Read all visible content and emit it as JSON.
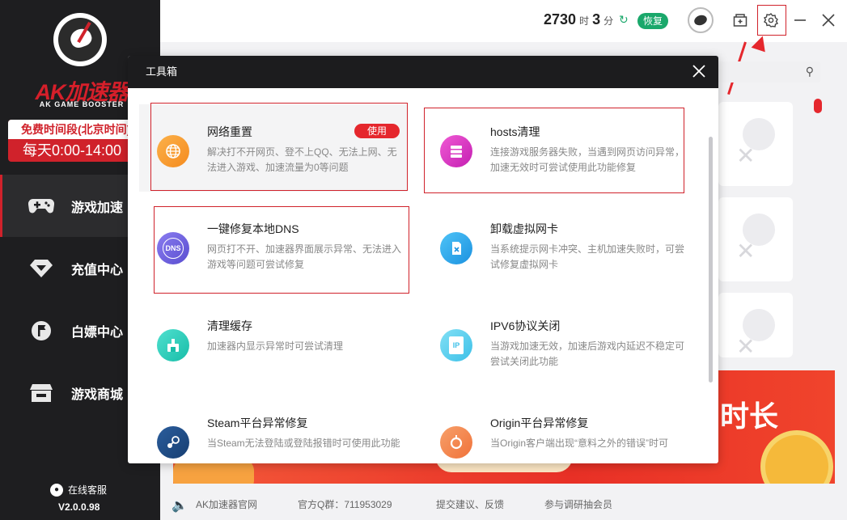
{
  "sidebar": {
    "brand": "AK加速器",
    "brand_sub": "AK GAME BOOSTER",
    "free_period_label": "免费时间段(北京时间)",
    "free_period_time": "每天0:00-14:00",
    "items": [
      {
        "label": "游戏加速",
        "icon": "gamepad-icon",
        "active": true
      },
      {
        "label": "充值中心",
        "icon": "diamond-icon",
        "active": false
      },
      {
        "label": "白嫖中心",
        "icon": "flag-badge-icon",
        "active": false
      },
      {
        "label": "游戏商城",
        "icon": "store-icon",
        "active": false
      }
    ],
    "support": "在线客服",
    "version": "V2.0.0.98"
  },
  "topbar": {
    "hours": "2730",
    "hours_unit": "时",
    "minutes": "3",
    "minutes_unit": "分",
    "restore_label": "恢复",
    "accent_color": "#1aa86b"
  },
  "modal": {
    "title": "工具箱",
    "tools": [
      {
        "title": "网络重置",
        "desc": "解决打不开网页、登不上QQ、无法上网、无法进入游戏、加速流量为0等问题",
        "icon": "globe-icon",
        "action": "使用"
      },
      {
        "title": "hosts清理",
        "desc": "连接游戏服务器失败，当遇到网页访问异常，加速无效时可尝试使用此功能修复",
        "icon": "server-icon"
      },
      {
        "title": "一键修复本地DNS",
        "desc": "网页打不开、加速器界面展示异常、无法进入游戏等问题可尝试修复",
        "icon": "dns-icon",
        "icon_text": "DNS"
      },
      {
        "title": "卸载虚拟网卡",
        "desc": "当系统提示网卡冲突、主机加速失败时，可尝试修复虚拟网卡",
        "icon": "network-card-icon"
      },
      {
        "title": "清理缓存",
        "desc": "加速器内显示异常时可尝试清理",
        "icon": "broom-icon"
      },
      {
        "title": "IPV6协议关闭",
        "desc": "当游戏加速无效，加速后游戏内延迟不稳定可尝试关闭此功能",
        "icon": "ip-document-icon",
        "icon_text": "IP"
      },
      {
        "title": "Steam平台异常修复",
        "desc": "当Steam无法登陆或登陆报错时可使用此功能",
        "icon": "steam-icon"
      },
      {
        "title": "Origin平台异常修复",
        "desc": "当Origin客户端出现“意料之外的错误”时可",
        "icon": "origin-icon"
      }
    ]
  },
  "background": {
    "banner_text": "时长"
  },
  "bottombar": {
    "website": "AK加速器官网",
    "qq_group": "官方Q群：711953029",
    "feedback": "提交建议、反馈",
    "survey": "参与调研抽会员"
  }
}
